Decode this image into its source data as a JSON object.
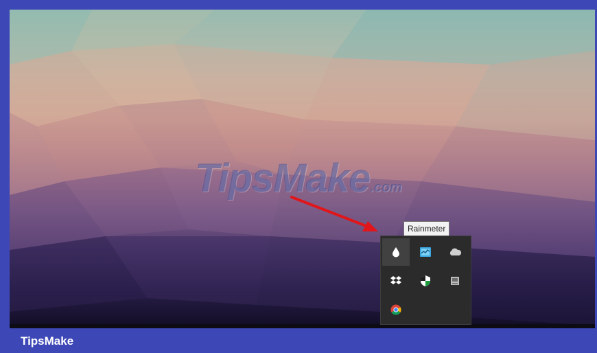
{
  "watermark": {
    "brand": "TipsMake",
    "suffix": ".com"
  },
  "tooltip": {
    "text": "Rainmeter"
  },
  "tray": {
    "icons": [
      {
        "name": "rainmeter-icon",
        "hovered": true
      },
      {
        "name": "network-monitor-icon",
        "hovered": false
      },
      {
        "name": "onedrive-icon",
        "hovered": false
      },
      {
        "name": "dropbox-icon",
        "hovered": false
      },
      {
        "name": "windows-defender-icon",
        "hovered": false
      },
      {
        "name": "storage-drive-icon",
        "hovered": false
      },
      {
        "name": "chrome-icon",
        "hovered": false
      }
    ]
  },
  "footer": {
    "label": "TipsMake"
  },
  "colors": {
    "frame": "#3d48b6",
    "arrow": "#e0161a",
    "tray_bg": "#2b2b2b"
  }
}
